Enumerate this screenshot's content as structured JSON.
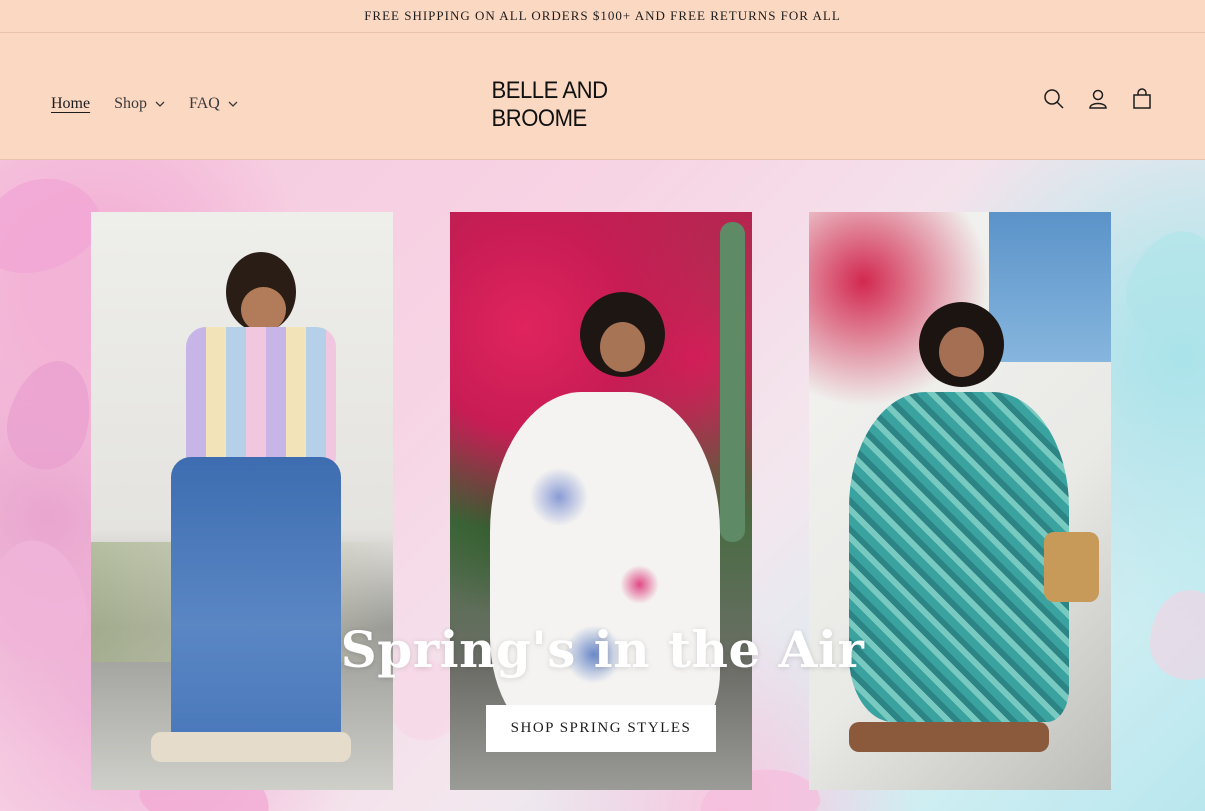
{
  "announcement": {
    "text": "FREE SHIPPING ON ALL ORDERS $100+ AND FREE RETURNS FOR ALL"
  },
  "header": {
    "logo": "BELLE AND BROOME",
    "nav": [
      {
        "label": "Home",
        "active": true,
        "dropdown": false
      },
      {
        "label": "Shop",
        "active": false,
        "dropdown": true
      },
      {
        "label": "FAQ",
        "active": false,
        "dropdown": true
      }
    ],
    "icons": [
      "search-icon",
      "account-icon",
      "cart-icon"
    ]
  },
  "hero": {
    "title": "Spring's in the Air",
    "cta_label": "SHOP SPRING STYLES",
    "photos": [
      {
        "name": "hero-photo-plaid-top"
      },
      {
        "name": "hero-photo-floral-dress"
      },
      {
        "name": "hero-photo-teal-dress"
      }
    ]
  },
  "colors": {
    "header_bg": "#fbd8c2",
    "text": "#1d1d1d",
    "cta_bg": "#ffffff"
  }
}
